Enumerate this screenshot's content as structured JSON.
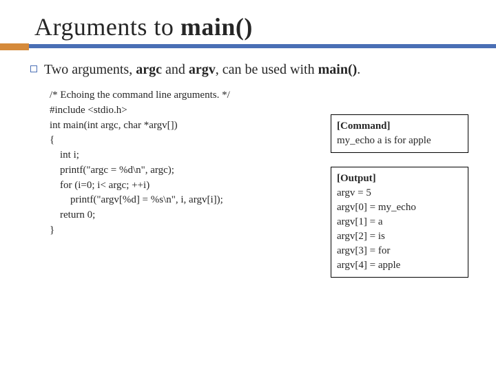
{
  "title": {
    "pre": "Arguments to ",
    "bold": "main()"
  },
  "bullet": {
    "p1": "Two arguments, ",
    "b1": "argc",
    "p2": " and ",
    "b2": "argv",
    "p3": ", can be used with ",
    "b3": "main()",
    "p4": "."
  },
  "code": {
    "l01": "/* Echoing the command line arguments. */",
    "l02": "#include <stdio.h>",
    "l03": "int main(int argc, char *argv[])",
    "l04": "{",
    "l05": "    int i;",
    "l06": "",
    "l07": "    printf(\"argc = %d\\n\", argc);",
    "l08": "    for (i=0; i< argc; ++i)",
    "l09": "        printf(\"argv[%d] = %s\\n\", i, argv[i]);",
    "l10": "",
    "l11": "    return 0;",
    "l12": "}"
  },
  "command_box": {
    "header": "[Command]",
    "line1": "my_echo a is for apple"
  },
  "output_box": {
    "header": "[Output]",
    "l1": "argv = 5",
    "l2": "argv[0] = my_echo",
    "l3": "argv[1] = a",
    "l4": "argv[2] = is",
    "l5": "argv[3] = for",
    "l6": "argv[4] = apple"
  }
}
